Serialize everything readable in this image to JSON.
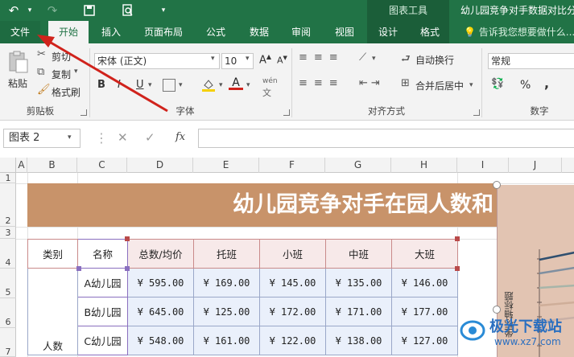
{
  "title_bar": {
    "context_group": "图表工具",
    "document_title": "幼儿园竞争对手数据对比分"
  },
  "tabs": [
    {
      "label": "文件"
    },
    {
      "label": "开始"
    },
    {
      "label": "插入"
    },
    {
      "label": "页面布局"
    },
    {
      "label": "公式"
    },
    {
      "label": "数据"
    },
    {
      "label": "审阅"
    },
    {
      "label": "视图"
    },
    {
      "label": "设计"
    },
    {
      "label": "格式"
    }
  ],
  "tell_me": "告诉我您想要做什么...",
  "ribbon": {
    "clipboard": {
      "paste": "粘贴",
      "cut": "剪切",
      "copy": "复制",
      "format_painter": "格式刷",
      "label": "剪贴板"
    },
    "font": {
      "name": "宋体 (正文)",
      "size": "10",
      "bold": "B",
      "italic": "I",
      "underline": "U",
      "label": "字体",
      "phonetic": "wén"
    },
    "alignment": {
      "wrap": "自动换行",
      "merge": "合并后居中",
      "label": "对齐方式"
    },
    "number": {
      "format": "常规",
      "label": "数字",
      "percent": "%",
      "comma": ","
    }
  },
  "formula_bar": {
    "name_box": "图表 2",
    "fx": "fx"
  },
  "columns": [
    "A",
    "B",
    "C",
    "D",
    "E",
    "F",
    "G",
    "H",
    "I",
    "J"
  ],
  "rows": [
    "1",
    "2",
    "3",
    "4",
    "5",
    "6",
    "7"
  ],
  "banner_title": "幼儿园竞争对手在园人数和",
  "table": {
    "headers": [
      "类别",
      "名称",
      "总数/均价",
      "托班",
      "小班",
      "中班",
      "大班"
    ],
    "category": "人数",
    "rows": [
      {
        "name": "A幼儿园",
        "values": [
          "¥ 595.00",
          "¥ 169.00",
          "¥ 145.00",
          "¥ 135.00",
          "¥ 146.00"
        ]
      },
      {
        "name": "B幼儿园",
        "values": [
          "¥ 645.00",
          "¥ 125.00",
          "¥ 172.00",
          "¥ 171.00",
          "¥ 177.00"
        ]
      },
      {
        "name": "C幼儿园",
        "values": [
          "¥ 548.00",
          "¥ 161.00",
          "¥ 122.00",
          "¥ 138.00",
          "¥ 127.00"
        ]
      }
    ]
  },
  "chart": {
    "axis_title": "坐标轴标题"
  },
  "watermark": {
    "brand": "极光下载站",
    "url": "www.xz7.com"
  },
  "colors": {
    "excel_green": "#217346",
    "banner": "#c8936a",
    "arrow": "#d0231c",
    "chart_bg": "#e2c4b2"
  }
}
